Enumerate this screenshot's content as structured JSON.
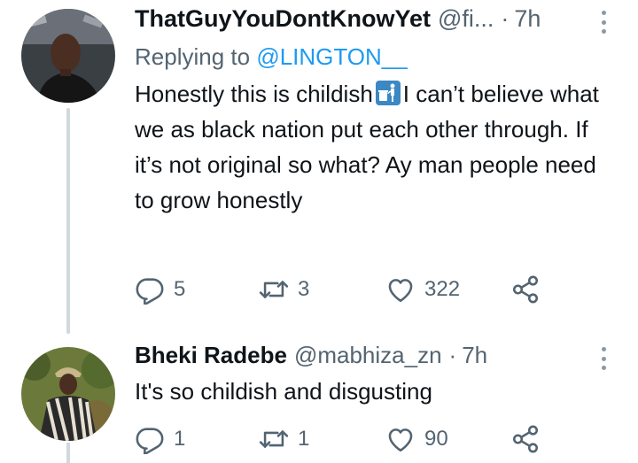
{
  "tweets": [
    {
      "name": "ThatGuyYouDontKnowYet",
      "handle": "@fi...",
      "separator": "·",
      "time": "7h",
      "replying_prefix": "Replying to",
      "replying_to": "@LINGTON__",
      "text_before_emoji": "Honestly this is childish",
      "emoji": "put-litter-in-its-place-icon",
      "text_after_emoji": "I can’t believe what we as black nation put each other through. If it’s not original so what? Ay man people need to grow honestly",
      "replies": "5",
      "retweets": "3",
      "likes": "322"
    },
    {
      "name": "Bheki Radebe",
      "handle": "@mabhiza_zn",
      "separator": "·",
      "time": "7h",
      "text": "It's so childish and disgusting",
      "replies": "1",
      "retweets": "1",
      "likes": "90"
    }
  ],
  "colors": {
    "secondary_text": "#536471",
    "link": "#1d9bf0",
    "thread_line": "#cfd9de",
    "emoji_bg": "#3b88c3"
  },
  "icons": [
    "reply-icon",
    "retweet-icon",
    "like-icon",
    "share-icon",
    "more-icon"
  ]
}
